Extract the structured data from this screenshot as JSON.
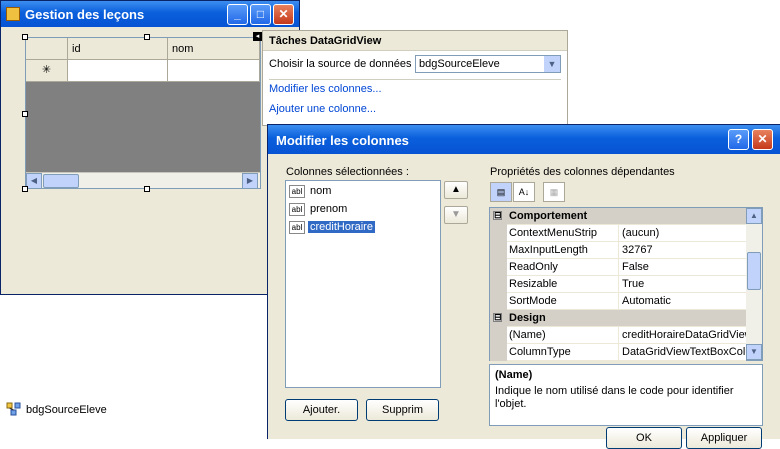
{
  "form": {
    "title": "Gestion des leçons",
    "grid": {
      "columns": [
        "id",
        "nom"
      ],
      "new_row_glyph": "✳"
    }
  },
  "tasks": {
    "title": "Tâches DataGridView",
    "source_label": "Choisir la source de données",
    "source_value": "bdgSourceEleve",
    "edit_columns_link": "Modifier les colonnes...",
    "add_column_link": "Ajouter une colonne..."
  },
  "tray": {
    "component_label": "bdgSourceEleve"
  },
  "dialog": {
    "title": "Modifier les colonnes",
    "help_button": "?",
    "close_button": "✕",
    "selected_columns_label": "Colonnes sélectionnées :",
    "columns": [
      {
        "icon_text": "abl",
        "name": "nom"
      },
      {
        "icon_text": "abl",
        "name": "prenom"
      },
      {
        "icon_text": "abl",
        "name": "creditHoraire",
        "selected": true
      }
    ],
    "move_up": "▲",
    "move_down": "▼",
    "add_button": "Ajouter.",
    "remove_button": "Supprim",
    "properties_label": "Propriétés des colonnes dépendantes",
    "property_grid": {
      "categories": [
        {
          "name": "Comportement",
          "expander": "⊟",
          "rows": [
            {
              "name": "ContextMenuStrip",
              "value": "(aucun)"
            },
            {
              "name": "MaxInputLength",
              "value": "32767"
            },
            {
              "name": "ReadOnly",
              "value": "False"
            },
            {
              "name": "Resizable",
              "value": "True"
            },
            {
              "name": "SortMode",
              "value": "Automatic"
            }
          ]
        },
        {
          "name": "Design",
          "expander": "⊟",
          "rows": [
            {
              "name": "(Name)",
              "value": "creditHoraireDataGridView"
            },
            {
              "name": "ColumnType",
              "value": "DataGridViewTextBoxColu"
            }
          ]
        }
      ]
    },
    "description": {
      "title": "(Name)",
      "text": "Indique le nom utilisé dans le code pour identifier l'objet."
    },
    "ok_button": "OK",
    "apply_button": "Appliquer"
  },
  "colors": {
    "titlebar_blue": "#0a5fdc",
    "selection_blue": "#316ac5",
    "dialog_bg": "#ece9d8",
    "link_blue": "#0046d5"
  }
}
